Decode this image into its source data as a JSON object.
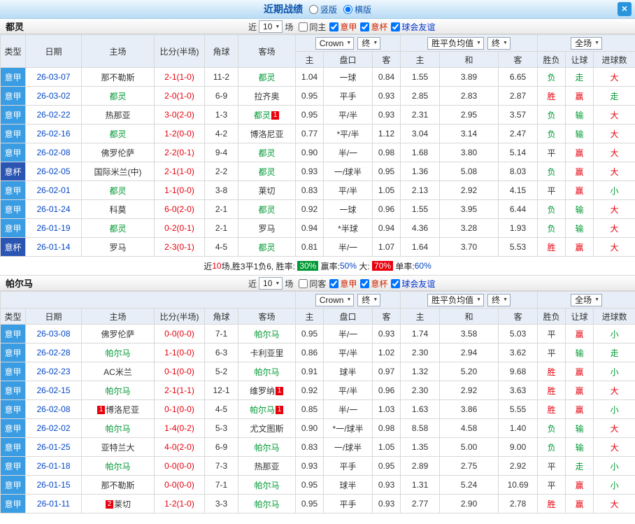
{
  "icons": {
    "caret_down": "▼",
    "close": "×"
  },
  "colors": {
    "red": "#e8000d",
    "green": "#009933",
    "link_blue": "#0547c4",
    "serie_a_blue": "#3a9ce2",
    "cup_blue": "#2b55b2",
    "header_bg": "#e7eef7",
    "titlebar_blue": "#0b55ad"
  },
  "titlebar": {
    "title": "近期战绩",
    "options": [
      {
        "label": "竖版",
        "selected": false
      },
      {
        "label": "横版",
        "selected": true
      }
    ]
  },
  "shared": {
    "near": "近",
    "games": "场"
  },
  "table_header": {
    "main_cols": [
      "类型",
      "日期",
      "主场",
      "比分(半场)",
      "角球",
      "客场"
    ],
    "sub_cols": [
      "主",
      "盘口",
      "客",
      "主",
      "和",
      "客",
      "胜负",
      "让球",
      "进球数"
    ],
    "dropdowns": {
      "company": "Crown",
      "final_a": "终",
      "avg": "胜平负均值",
      "final_b": "终",
      "scope": "全场"
    }
  },
  "sections": [
    {
      "team": "都灵",
      "controls": {
        "count": "10",
        "checkboxes": [
          {
            "label": "同主",
            "checked": false,
            "color": "#333333"
          },
          {
            "label": "意甲",
            "checked": true,
            "color": "#cc2200"
          },
          {
            "label": "意杯",
            "checked": true,
            "color": "#cc2200"
          },
          {
            "label": "球会友谊",
            "checked": true,
            "color": "#0033cc"
          }
        ]
      },
      "rows": [
        {
          "league": "意甲",
          "league_type": "league",
          "date": "26-03-07",
          "home": {
            "name": "那不勒斯",
            "focal": false
          },
          "score": "2-1(1-0)",
          "corners": "11-2",
          "away": {
            "name": "都灵",
            "focal": true
          },
          "asia": [
            "1.04",
            "一球",
            "0.84"
          ],
          "avg": [
            "1.55",
            "3.89",
            "6.65"
          ],
          "wdl": "负",
          "rang": "走",
          "goals": "大"
        },
        {
          "league": "意甲",
          "league_type": "league",
          "date": "26-03-02",
          "home": {
            "name": "都灵",
            "focal": true
          },
          "score": "2-0(1-0)",
          "corners": "6-9",
          "away": {
            "name": "拉齐奥",
            "focal": false
          },
          "asia": [
            "0.95",
            "平手",
            "0.93"
          ],
          "avg": [
            "2.85",
            "2.83",
            "2.87"
          ],
          "wdl": "胜",
          "rang": "赢",
          "goals": "走"
        },
        {
          "league": "意甲",
          "league_type": "league",
          "date": "26-02-22",
          "home": {
            "name": "热那亚",
            "focal": false
          },
          "score": "3-0(2-0)",
          "corners": "1-3",
          "away": {
            "name": "都灵",
            "focal": true,
            "badge": "1"
          },
          "asia": [
            "0.95",
            "平/半",
            "0.93"
          ],
          "avg": [
            "2.31",
            "2.95",
            "3.57"
          ],
          "wdl": "负",
          "rang": "输",
          "goals": "大"
        },
        {
          "league": "意甲",
          "league_type": "league",
          "date": "26-02-16",
          "home": {
            "name": "都灵",
            "focal": true
          },
          "score": "1-2(0-0)",
          "corners": "4-2",
          "away": {
            "name": "博洛尼亚",
            "focal": false
          },
          "asia": [
            "0.77",
            "*平/半",
            "1.12"
          ],
          "avg": [
            "3.04",
            "3.14",
            "2.47"
          ],
          "wdl": "负",
          "rang": "输",
          "goals": "大"
        },
        {
          "league": "意甲",
          "league_type": "league",
          "date": "26-02-08",
          "home": {
            "name": "佛罗伦萨",
            "focal": false
          },
          "score": "2-2(0-1)",
          "corners": "9-4",
          "away": {
            "name": "都灵",
            "focal": true
          },
          "asia": [
            "0.90",
            "半/一",
            "0.98"
          ],
          "avg": [
            "1.68",
            "3.80",
            "5.14"
          ],
          "wdl": "平",
          "rang": "赢",
          "goals": "大"
        },
        {
          "league": "意杯",
          "league_type": "cup",
          "date": "26-02-05",
          "home": {
            "name": "国际米兰(中)",
            "focal": false
          },
          "score": "2-1(1-0)",
          "corners": "2-2",
          "away": {
            "name": "都灵",
            "focal": true
          },
          "asia": [
            "0.93",
            "一/球半",
            "0.95"
          ],
          "avg": [
            "1.36",
            "5.08",
            "8.03"
          ],
          "wdl": "负",
          "rang": "赢",
          "goals": "大"
        },
        {
          "league": "意甲",
          "league_type": "league",
          "date": "26-02-01",
          "home": {
            "name": "都灵",
            "focal": true
          },
          "score": "1-1(0-0)",
          "corners": "3-8",
          "away": {
            "name": "莱切",
            "focal": false
          },
          "asia": [
            "0.83",
            "平/半",
            "1.05"
          ],
          "avg": [
            "2.13",
            "2.92",
            "4.15"
          ],
          "wdl": "平",
          "rang": "赢",
          "goals": "小"
        },
        {
          "league": "意甲",
          "league_type": "league",
          "date": "26-01-24",
          "home": {
            "name": "科莫",
            "focal": false
          },
          "score": "6-0(2-0)",
          "corners": "2-1",
          "away": {
            "name": "都灵",
            "focal": true
          },
          "asia": [
            "0.92",
            "一球",
            "0.96"
          ],
          "avg": [
            "1.55",
            "3.95",
            "6.44"
          ],
          "wdl": "负",
          "rang": "输",
          "goals": "大"
        },
        {
          "league": "意甲",
          "league_type": "league",
          "date": "26-01-19",
          "home": {
            "name": "都灵",
            "focal": true
          },
          "score": "0-2(0-1)",
          "corners": "2-1",
          "away": {
            "name": "罗马",
            "focal": false
          },
          "asia": [
            "0.94",
            "*半球",
            "0.94"
          ],
          "avg": [
            "4.36",
            "3.28",
            "1.93"
          ],
          "wdl": "负",
          "rang": "输",
          "goals": "大"
        },
        {
          "league": "意杯",
          "league_type": "cup",
          "date": "26-01-14",
          "home": {
            "name": "罗马",
            "focal": false
          },
          "score": "2-3(0-1)",
          "corners": "4-5",
          "away": {
            "name": "都灵",
            "focal": true
          },
          "asia": [
            "0.81",
            "半/一",
            "1.07"
          ],
          "avg": [
            "1.64",
            "3.70",
            "5.53"
          ],
          "wdl": "胜",
          "rang": "赢",
          "goals": "大"
        }
      ],
      "summary": [
        {
          "text": "近",
          "c": "dark"
        },
        {
          "text": "10",
          "c": "red"
        },
        {
          "text": "场,胜3平1负6,",
          "c": "dark"
        },
        {
          "text": " 胜率: ",
          "c": "dark"
        },
        {
          "text": "30%",
          "c": "badge-green"
        },
        {
          "text": " 赢率:",
          "c": "dark"
        },
        {
          "text": "50%",
          "c": "blue"
        },
        {
          "text": " 大: ",
          "c": "dark"
        },
        {
          "text": "70%",
          "c": "badge-red"
        },
        {
          "text": " 单率:",
          "c": "dark"
        },
        {
          "text": "60%",
          "c": "blue"
        }
      ]
    },
    {
      "team": "帕尔马",
      "controls": {
        "count": "10",
        "checkboxes": [
          {
            "label": "同客",
            "checked": false,
            "color": "#333333"
          },
          {
            "label": "意甲",
            "checked": true,
            "color": "#cc2200"
          },
          {
            "label": "意杯",
            "checked": true,
            "color": "#cc2200"
          },
          {
            "label": "球会友谊",
            "checked": true,
            "color": "#0033cc"
          }
        ]
      },
      "rows": [
        {
          "league": "意甲",
          "league_type": "league",
          "date": "26-03-08",
          "home": {
            "name": "佛罗伦萨",
            "focal": false
          },
          "score": "0-0(0-0)",
          "corners": "7-1",
          "away": {
            "name": "帕尔马",
            "focal": true
          },
          "asia": [
            "0.95",
            "半/一",
            "0.93"
          ],
          "avg": [
            "1.74",
            "3.58",
            "5.03"
          ],
          "wdl": "平",
          "rang": "赢",
          "goals": "小"
        },
        {
          "league": "意甲",
          "league_type": "league",
          "date": "26-02-28",
          "home": {
            "name": "帕尔马",
            "focal": true
          },
          "score": "1-1(0-0)",
          "corners": "6-3",
          "away": {
            "name": "卡利亚里",
            "focal": false
          },
          "asia": [
            "0.86",
            "平/半",
            "1.02"
          ],
          "avg": [
            "2.30",
            "2.94",
            "3.62"
          ],
          "wdl": "平",
          "rang": "输",
          "goals": "走"
        },
        {
          "league": "意甲",
          "league_type": "league",
          "date": "26-02-23",
          "home": {
            "name": "AC米兰",
            "focal": false
          },
          "score": "0-1(0-0)",
          "corners": "5-2",
          "away": {
            "name": "帕尔马",
            "focal": true
          },
          "asia": [
            "0.91",
            "球半",
            "0.97"
          ],
          "avg": [
            "1.32",
            "5.20",
            "9.68"
          ],
          "wdl": "胜",
          "rang": "赢",
          "goals": "小"
        },
        {
          "league": "意甲",
          "league_type": "league",
          "date": "26-02-15",
          "home": {
            "name": "帕尔马",
            "focal": true
          },
          "score": "2-1(1-1)",
          "corners": "12-1",
          "away": {
            "name": "维罗纳",
            "focal": false,
            "badge": "1"
          },
          "asia": [
            "0.92",
            "平/半",
            "0.96"
          ],
          "avg": [
            "2.30",
            "2.92",
            "3.63"
          ],
          "wdl": "胜",
          "rang": "赢",
          "goals": "大"
        },
        {
          "league": "意甲",
          "league_type": "league",
          "date": "26-02-08",
          "home": {
            "name": "博洛尼亚",
            "focal": false,
            "badge_pre": "1"
          },
          "score": "0-1(0-0)",
          "corners": "4-5",
          "away": {
            "name": "帕尔马",
            "focal": true,
            "badge": "1"
          },
          "asia": [
            "0.85",
            "半/一",
            "1.03"
          ],
          "avg": [
            "1.63",
            "3.86",
            "5.55"
          ],
          "wdl": "胜",
          "rang": "赢",
          "goals": "小"
        },
        {
          "league": "意甲",
          "league_type": "league",
          "date": "26-02-02",
          "home": {
            "name": "帕尔马",
            "focal": true
          },
          "score": "1-4(0-2)",
          "corners": "5-3",
          "away": {
            "name": "尤文图斯",
            "focal": false
          },
          "asia": [
            "0.90",
            "*一/球半",
            "0.98"
          ],
          "avg": [
            "8.58",
            "4.58",
            "1.40"
          ],
          "wdl": "负",
          "rang": "输",
          "goals": "大"
        },
        {
          "league": "意甲",
          "league_type": "league",
          "date": "26-01-25",
          "home": {
            "name": "亚特兰大",
            "focal": false
          },
          "score": "4-0(2-0)",
          "corners": "6-9",
          "away": {
            "name": "帕尔马",
            "focal": true
          },
          "asia": [
            "0.83",
            "一/球半",
            "1.05"
          ],
          "avg": [
            "1.35",
            "5.00",
            "9.00"
          ],
          "wdl": "负",
          "rang": "输",
          "goals": "大"
        },
        {
          "league": "意甲",
          "league_type": "league",
          "date": "26-01-18",
          "home": {
            "name": "帕尔马",
            "focal": true
          },
          "score": "0-0(0-0)",
          "corners": "7-3",
          "away": {
            "name": "热那亚",
            "focal": false
          },
          "asia": [
            "0.93",
            "平手",
            "0.95"
          ],
          "avg": [
            "2.89",
            "2.75",
            "2.92"
          ],
          "wdl": "平",
          "rang": "走",
          "goals": "小"
        },
        {
          "league": "意甲",
          "league_type": "league",
          "date": "26-01-15",
          "home": {
            "name": "那不勒斯",
            "focal": false
          },
          "score": "0-0(0-0)",
          "corners": "7-1",
          "away": {
            "name": "帕尔马",
            "focal": true
          },
          "asia": [
            "0.95",
            "球半",
            "0.93"
          ],
          "avg": [
            "1.31",
            "5.24",
            "10.69"
          ],
          "wdl": "平",
          "rang": "赢",
          "goals": "小"
        },
        {
          "league": "意甲",
          "league_type": "league",
          "date": "26-01-11",
          "home": {
            "name": "莱切",
            "focal": false,
            "badge_pre": "2"
          },
          "score": "1-2(1-0)",
          "corners": "3-3",
          "away": {
            "name": "帕尔马",
            "focal": true
          },
          "asia": [
            "0.95",
            "平手",
            "0.93"
          ],
          "avg": [
            "2.77",
            "2.90",
            "2.78"
          ],
          "wdl": "胜",
          "rang": "赢",
          "goals": "大"
        }
      ],
      "summary": null
    }
  ]
}
